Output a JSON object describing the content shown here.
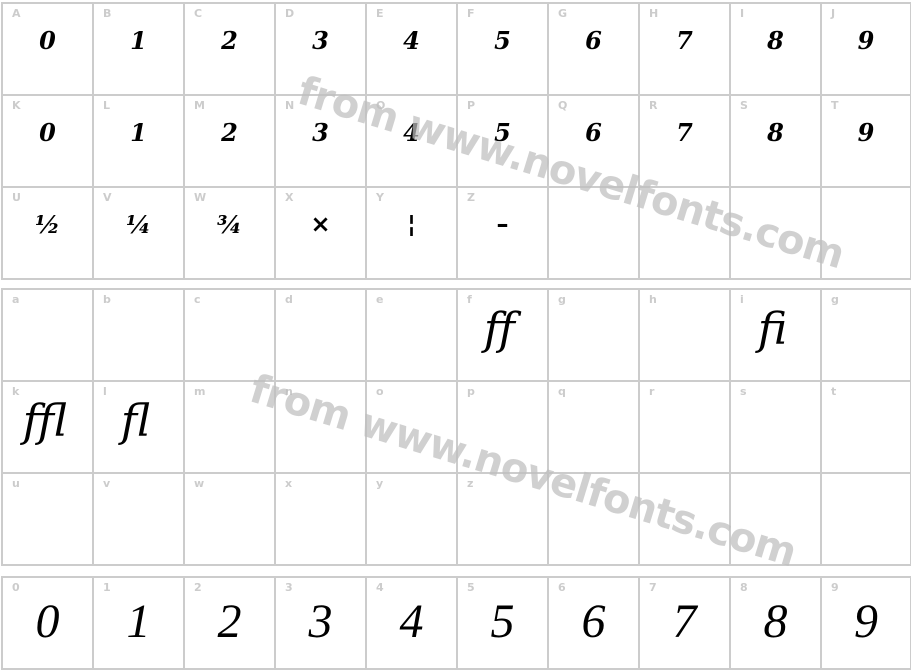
{
  "sections": [
    {
      "rows": [
        {
          "cells": [
            {
              "label": "A",
              "glyph": "0"
            },
            {
              "label": "B",
              "glyph": "1"
            },
            {
              "label": "C",
              "glyph": "2"
            },
            {
              "label": "D",
              "glyph": "3"
            },
            {
              "label": "E",
              "glyph": "4"
            },
            {
              "label": "F",
              "glyph": "5"
            },
            {
              "label": "G",
              "glyph": "6"
            },
            {
              "label": "H",
              "glyph": "7"
            },
            {
              "label": "I",
              "glyph": "8"
            },
            {
              "label": "J",
              "glyph": "9"
            }
          ]
        },
        {
          "cells": [
            {
              "label": "K",
              "glyph": "0"
            },
            {
              "label": "L",
              "glyph": "1"
            },
            {
              "label": "M",
              "glyph": "2"
            },
            {
              "label": "N",
              "glyph": "3"
            },
            {
              "label": "O",
              "glyph": "4"
            },
            {
              "label": "P",
              "glyph": "5"
            },
            {
              "label": "Q",
              "glyph": "6"
            },
            {
              "label": "R",
              "glyph": "7"
            },
            {
              "label": "S",
              "glyph": "8"
            },
            {
              "label": "T",
              "glyph": "9"
            }
          ]
        },
        {
          "cells": [
            {
              "label": "U",
              "glyph": "½"
            },
            {
              "label": "V",
              "glyph": "¼"
            },
            {
              "label": "W",
              "glyph": "¾"
            },
            {
              "label": "X",
              "glyph": "×"
            },
            {
              "label": "Y",
              "glyph": "¦"
            },
            {
              "label": "Z",
              "glyph": "–"
            },
            {
              "label": "",
              "glyph": ""
            },
            {
              "label": "",
              "glyph": ""
            },
            {
              "label": "",
              "glyph": ""
            },
            {
              "label": "",
              "glyph": ""
            }
          ]
        }
      ]
    },
    {
      "rows": [
        {
          "cells": [
            {
              "label": "a",
              "glyph": ""
            },
            {
              "label": "b",
              "glyph": ""
            },
            {
              "label": "c",
              "glyph": ""
            },
            {
              "label": "d",
              "glyph": ""
            },
            {
              "label": "e",
              "glyph": ""
            },
            {
              "label": "f",
              "glyph": "ff"
            },
            {
              "label": "g",
              "glyph": ""
            },
            {
              "label": "h",
              "glyph": ""
            },
            {
              "label": "i",
              "glyph": "fi"
            },
            {
              "label": "g",
              "glyph": ""
            }
          ]
        },
        {
          "cells": [
            {
              "label": "k",
              "glyph": "ffl"
            },
            {
              "label": "l",
              "glyph": "fl"
            },
            {
              "label": "m",
              "glyph": ""
            },
            {
              "label": "n",
              "glyph": ""
            },
            {
              "label": "o",
              "glyph": ""
            },
            {
              "label": "p",
              "glyph": ""
            },
            {
              "label": "q",
              "glyph": ""
            },
            {
              "label": "r",
              "glyph": ""
            },
            {
              "label": "s",
              "glyph": ""
            },
            {
              "label": "t",
              "glyph": ""
            }
          ]
        },
        {
          "cells": [
            {
              "label": "u",
              "glyph": ""
            },
            {
              "label": "v",
              "glyph": ""
            },
            {
              "label": "w",
              "glyph": ""
            },
            {
              "label": "x",
              "glyph": ""
            },
            {
              "label": "y",
              "glyph": ""
            },
            {
              "label": "z",
              "glyph": ""
            },
            {
              "label": "",
              "glyph": ""
            },
            {
              "label": "",
              "glyph": ""
            },
            {
              "label": "",
              "glyph": ""
            },
            {
              "label": "",
              "glyph": ""
            }
          ]
        }
      ]
    },
    {
      "rows": [
        {
          "cells": [
            {
              "label": "0",
              "glyph": "0"
            },
            {
              "label": "1",
              "glyph": "1"
            },
            {
              "label": "2",
              "glyph": "2"
            },
            {
              "label": "3",
              "glyph": "3"
            },
            {
              "label": "4",
              "glyph": "4"
            },
            {
              "label": "5",
              "glyph": "5"
            },
            {
              "label": "6",
              "glyph": "6"
            },
            {
              "label": "7",
              "glyph": "7"
            },
            {
              "label": "8",
              "glyph": "8"
            },
            {
              "label": "9",
              "glyph": "9"
            }
          ]
        }
      ]
    }
  ],
  "watermark": {
    "text": "from www.novelfonts.com"
  }
}
